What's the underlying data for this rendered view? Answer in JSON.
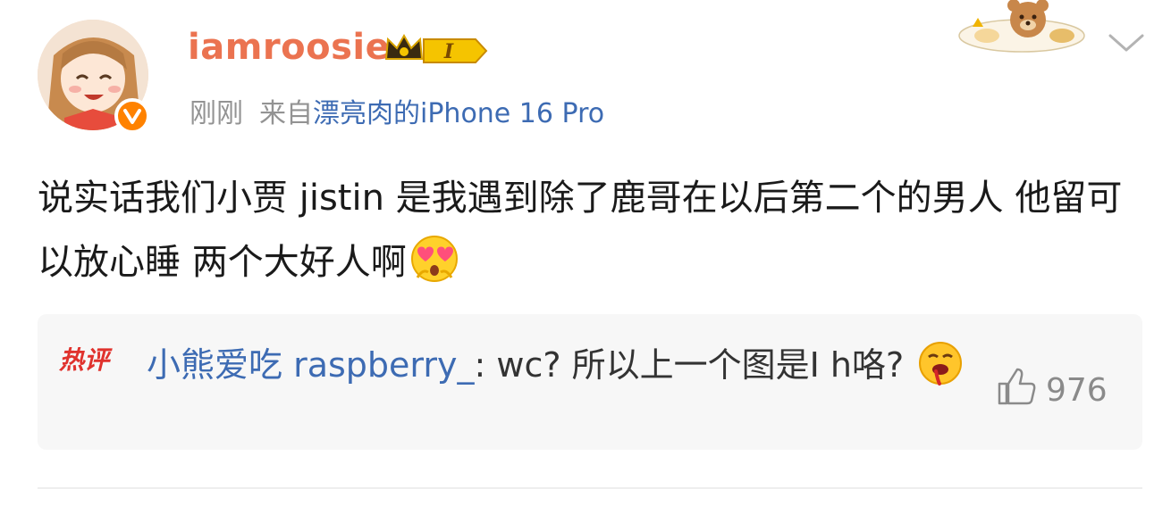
{
  "post": {
    "username": "iamroosie",
    "level": "I",
    "time": "刚刚",
    "source_prefix": "来自",
    "device": "漂亮肉的iPhone 16 Pro",
    "text": "说实话我们小贾 jistin 是我遇到除了鹿哥在以后第二个的男人 他留可以放心睡 两个大好人啊",
    "text_emoji": "heart-eyes-emoji"
  },
  "hot_comment": {
    "tag": "热评",
    "user": "小熊爱吃 raspberry_",
    "text": ": wc?  所以上一个图是I h咯?",
    "emoji": "drooling-emoji",
    "likes": "976"
  },
  "colors": {
    "username": "#eb7350",
    "link": "#3d6bb3",
    "meta": "#939393",
    "verified": "#ff8200",
    "hot_tag": "#e0322d"
  }
}
